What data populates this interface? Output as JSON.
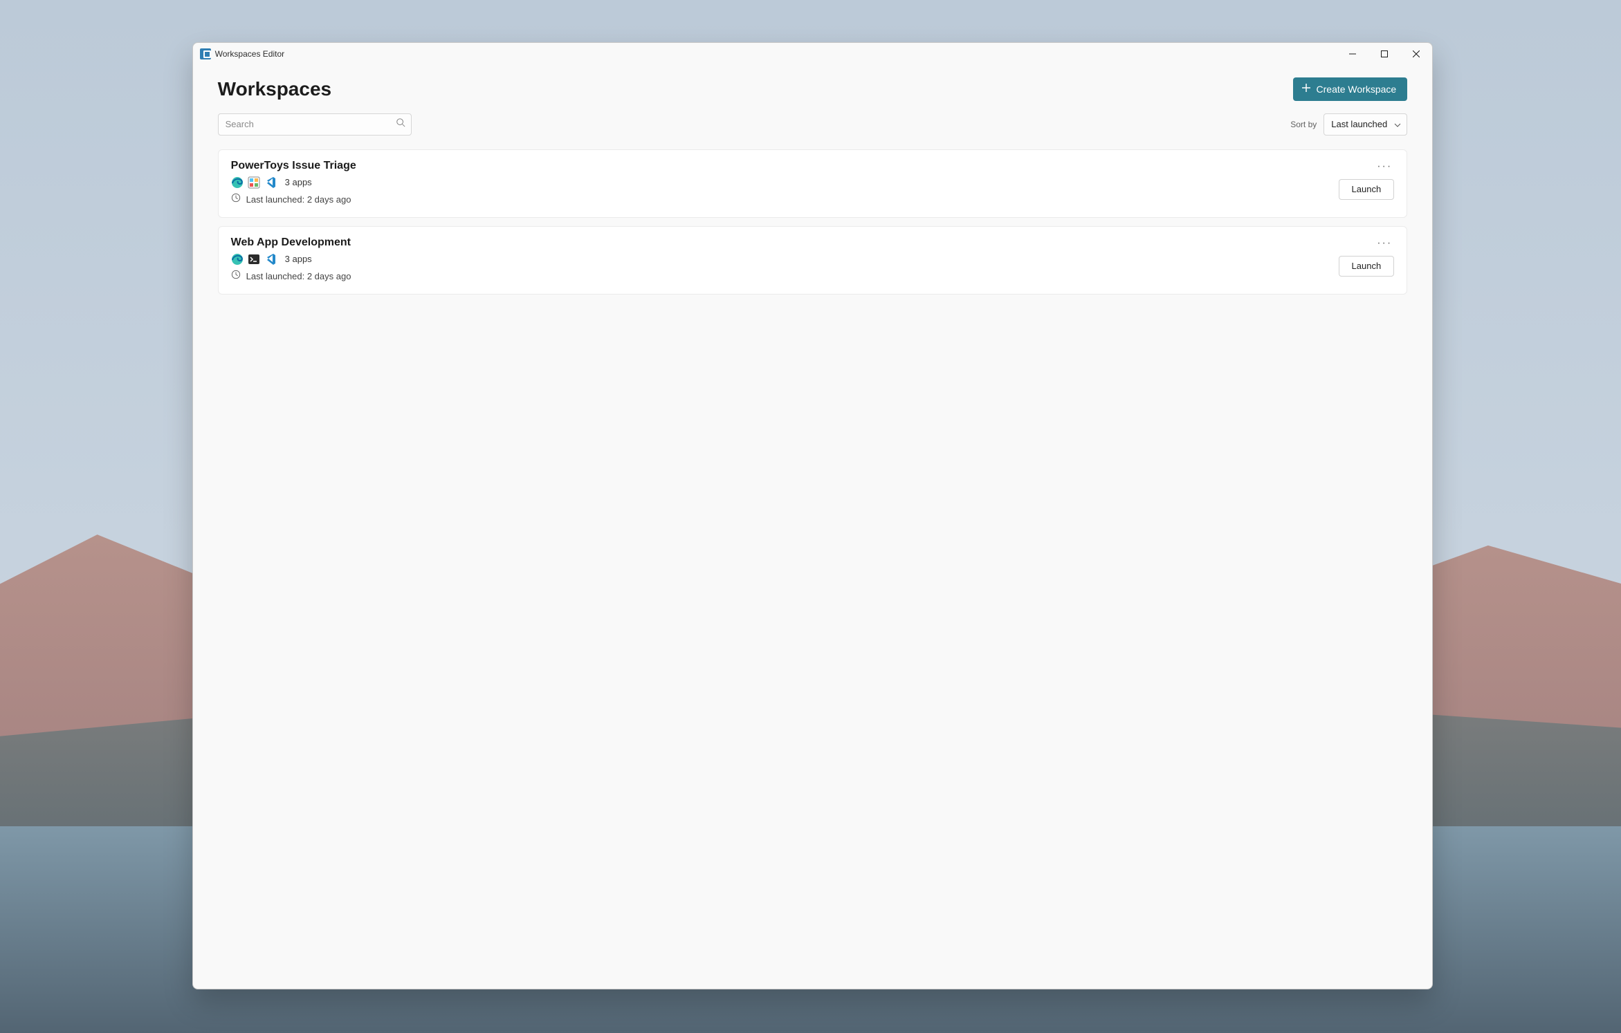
{
  "window": {
    "title": "Workspaces Editor"
  },
  "header": {
    "page_title": "Workspaces",
    "create_button_label": "Create Workspace"
  },
  "toolbar": {
    "search_placeholder": "Search",
    "sort_label": "Sort by",
    "sort_value": "Last launched"
  },
  "cards": [
    {
      "title": "PowerToys Issue Triage",
      "apps_icons": [
        "edge",
        "powertoys",
        "vscode"
      ],
      "app_count_label": "3 apps",
      "last_launched_label": "Last launched: 2 days ago",
      "launch_label": "Launch"
    },
    {
      "title": "Web App Development",
      "apps_icons": [
        "edge",
        "terminal",
        "vscode"
      ],
      "app_count_label": "3 apps",
      "last_launched_label": "Last launched: 2 days ago",
      "launch_label": "Launch"
    }
  ]
}
